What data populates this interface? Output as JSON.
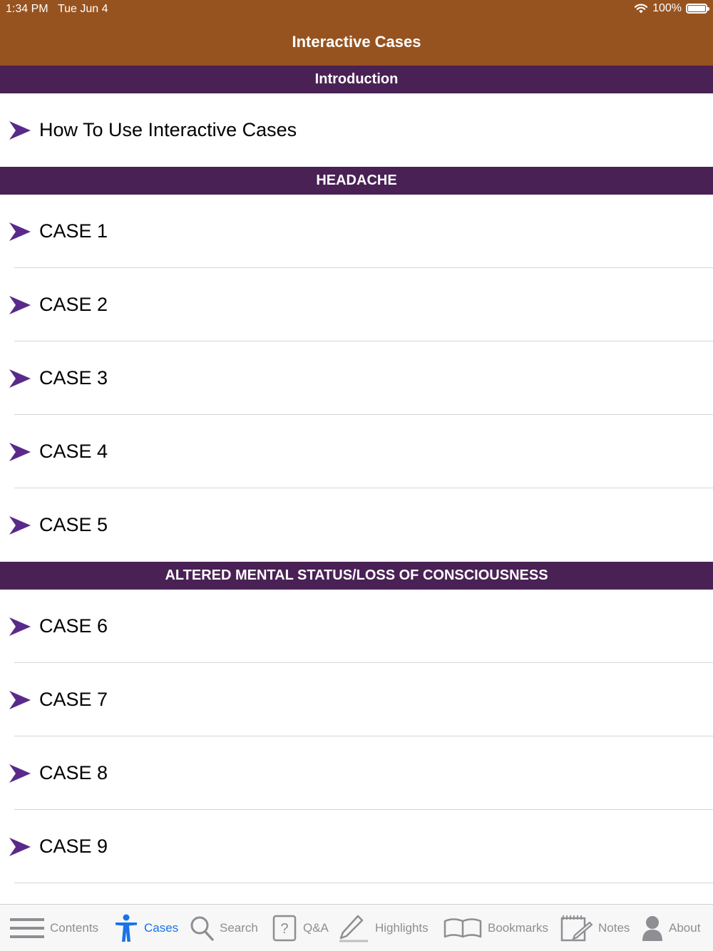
{
  "status_bar": {
    "time": "1:34 PM",
    "date": "Tue Jun 4",
    "wifi_icon": "wifi-icon",
    "battery": "100%"
  },
  "nav": {
    "title": "Interactive Cases"
  },
  "colors": {
    "nav_bar": "#97531f",
    "section_header": "#4a2155",
    "active_tab": "#1a73e8",
    "arrow": "#5a2a8a"
  },
  "sections": [
    {
      "title": "Introduction",
      "items": [
        {
          "label": "How To Use Interactive Cases"
        }
      ]
    },
    {
      "title": "HEADACHE",
      "items": [
        {
          "label": "CASE 1"
        },
        {
          "label": "CASE 2"
        },
        {
          "label": "CASE 3"
        },
        {
          "label": "CASE 4"
        },
        {
          "label": "CASE 5"
        }
      ]
    },
    {
      "title": "ALTERED MENTAL STATUS/LOSS OF CONSCIOUSNESS",
      "items": [
        {
          "label": "CASE 6"
        },
        {
          "label": "CASE 7"
        },
        {
          "label": "CASE 8"
        },
        {
          "label": "CASE 9"
        }
      ]
    }
  ],
  "tabbar": {
    "tabs": [
      {
        "label": "Contents",
        "icon": "list-icon"
      },
      {
        "label": "Cases",
        "icon": "person-icon",
        "active": true
      },
      {
        "label": "Search",
        "icon": "search-icon"
      },
      {
        "label": "Q&A",
        "icon": "question-icon"
      },
      {
        "label": "Highlights",
        "icon": "pen-icon"
      },
      {
        "label": "Bookmarks",
        "icon": "book-icon"
      },
      {
        "label": "Notes",
        "icon": "notepad-icon"
      },
      {
        "label": "About",
        "icon": "user-icon"
      }
    ]
  }
}
